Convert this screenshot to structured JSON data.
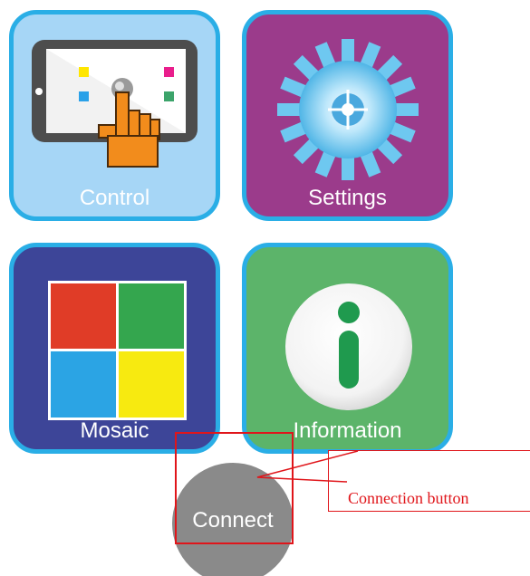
{
  "tiles": {
    "control": {
      "label": "Control",
      "icon": "tablet-touch-icon",
      "color": "#a6d6f6"
    },
    "settings": {
      "label": "Settings",
      "icon": "gear-icon",
      "color": "#9b3b8b"
    },
    "mosaic": {
      "label": "Mosaic",
      "icon": "mosaic-grid-icon",
      "color": "#3d4598"
    },
    "information": {
      "label": "Information",
      "icon": "info-icon",
      "color": "#5cb46a"
    }
  },
  "connect": {
    "label": "Connect",
    "color": "#8a8a8a"
  },
  "annotation": {
    "text": "Connection button",
    "color": "#e0151a"
  },
  "colors": {
    "tile_border": "#2aaee6"
  }
}
